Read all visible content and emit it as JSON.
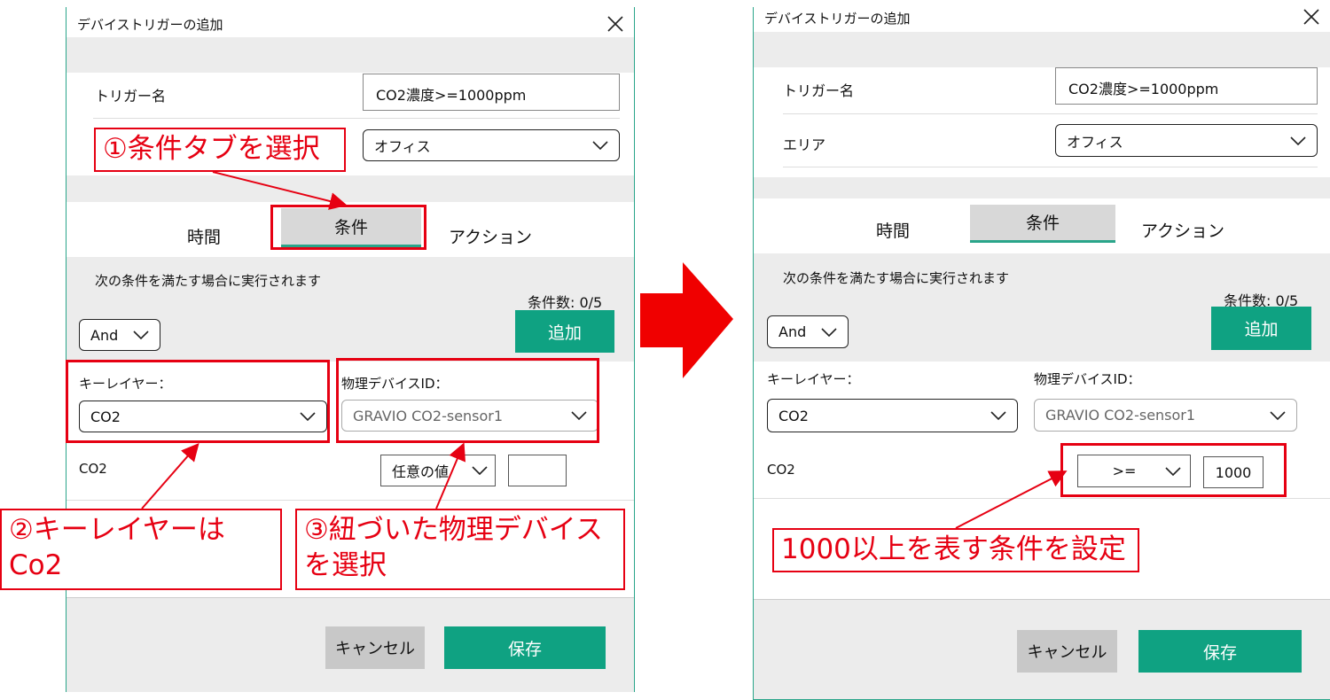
{
  "left_dialog": {
    "title": "デバイストリガーの追加",
    "trigger_name_label": "トリガー名",
    "trigger_name_value": "CO2濃度>=1000ppm",
    "area_value": "オフィス",
    "tabs": [
      "時間",
      "条件",
      "アクション"
    ],
    "condition_desc": "次の条件を満たす場合に実行されます",
    "condition_count": "条件数: 0/5",
    "logic_value": "And",
    "add_label": "追加",
    "key_layer_label": "キーレイヤー：",
    "key_layer_value": "CO2",
    "device_id_label": "物理デバイスID：",
    "device_id_value": "GRAVIO CO2-sensor1",
    "row_label": "CO2",
    "operator_value": "任意の値",
    "number_value": "",
    "cancel_label": "キャンセル",
    "save_label": "保存"
  },
  "right_dialog": {
    "title": "デバイストリガーの追加",
    "trigger_name_label": "トリガー名",
    "trigger_name_value": "CO2濃度>=1000ppm",
    "area_label": "エリア",
    "area_value": "オフィス",
    "tabs": [
      "時間",
      "条件",
      "アクション"
    ],
    "condition_desc": "次の条件を満たす場合に実行されます",
    "condition_count": "条件数: 0/5",
    "logic_value": "And",
    "add_label": "追加",
    "key_layer_label": "キーレイヤー：",
    "key_layer_value": "CO2",
    "device_id_label": "物理デバイスID：",
    "device_id_value": "GRAVIO CO2-sensor1",
    "row_label": "CO2",
    "operator_value": ">=",
    "number_value": "1000",
    "cancel_label": "キャンセル",
    "save_label": "保存"
  },
  "annotations": {
    "step1": "①条件タブを選択",
    "step2_line1": "②キーレイヤーは",
    "step2_line2": "Co2",
    "step3_line1": "③紐づいた物理デバイス",
    "step3_line2": "を選択",
    "right_note": "1000以上を表す条件を設定"
  },
  "colors": {
    "accent": "#0fa282",
    "annotation_red": "#e60012",
    "band_gray": "#ececec",
    "cancel_gray": "#c8c8c8"
  },
  "icons": [
    "close-icon",
    "chevron-down-icon",
    "arrow-right-icon"
  ]
}
